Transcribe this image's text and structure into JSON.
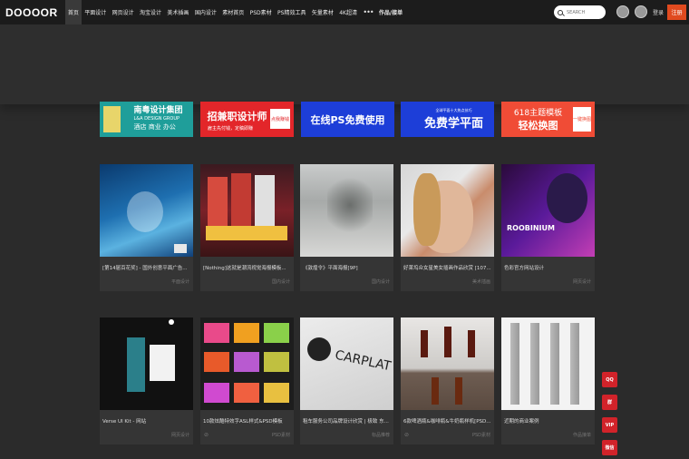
{
  "header": {
    "logo": "DOOOOR",
    "nav": [
      {
        "label": "首页",
        "active": true
      },
      {
        "label": "平面设计"
      },
      {
        "label": "网页设计"
      },
      {
        "label": "淘宝设计"
      },
      {
        "label": "美术插画"
      },
      {
        "label": "国内设计"
      },
      {
        "label": "素材首页"
      },
      {
        "label": "PSD素材"
      },
      {
        "label": "PS精效工具"
      },
      {
        "label": "矢量素材"
      },
      {
        "label": "4K超清"
      },
      {
        "label": "•••"
      },
      {
        "label": "作品/接单"
      }
    ],
    "search_placeholder": "SEARCH",
    "login": "登录",
    "register": "注册"
  },
  "ads": [
    {
      "title": "南粤设计集团",
      "subtitle": "L&A DESIGN GROUP",
      "tagline": "酒店 商业 办公"
    },
    {
      "title": "招兼职设计师",
      "subtitle": "雇主先付钱，定稿即赚",
      "badge": "点我赚钱"
    },
    {
      "title": "在线PS免费使用"
    },
    {
      "title": "免费学平面",
      "subtitle": "全球平面十大热点技巧"
    },
    {
      "title": "618主题模板",
      "subtitle": "轻松换图",
      "badge": "一键换图"
    }
  ],
  "cards_row1": [
    {
      "title": "[第14届百花奖] - 国外创意平面广告...",
      "category": "平面设计"
    },
    {
      "title": "[Nothing]这就是潮流视觉海报模板...",
      "category": "国内设计"
    },
    {
      "title": "《敦煌令》平面海报[9P]",
      "category": "国内设计"
    },
    {
      "title": "好莱坞众女星美女插画作品欣赏 [107...",
      "category": "美术插画"
    },
    {
      "title": "色彩官方网站设计",
      "category": "网页设计",
      "thumb_text": "ROOBINIUM"
    }
  ],
  "cards_row2": [
    {
      "title": "Verse UI Kit - 网站",
      "category": "网页设计"
    },
    {
      "title": "10款炫酷特效字ASL样式&PSD模板",
      "category": "PSD素材"
    },
    {
      "title": "租车服务公司品牌设计欣赏 | 极致 东...",
      "category": "标品推荐",
      "thumb_text": "CARPLAT"
    },
    {
      "title": "6款啤酒瓶&咖啡瓶&牛奶瓶样机[PSD...",
      "category": "PSD素材"
    },
    {
      "title": "近期的商业案例",
      "category": "作品接单"
    }
  ],
  "side_buttons": [
    "QQ",
    "群",
    "VIP",
    "微信"
  ]
}
